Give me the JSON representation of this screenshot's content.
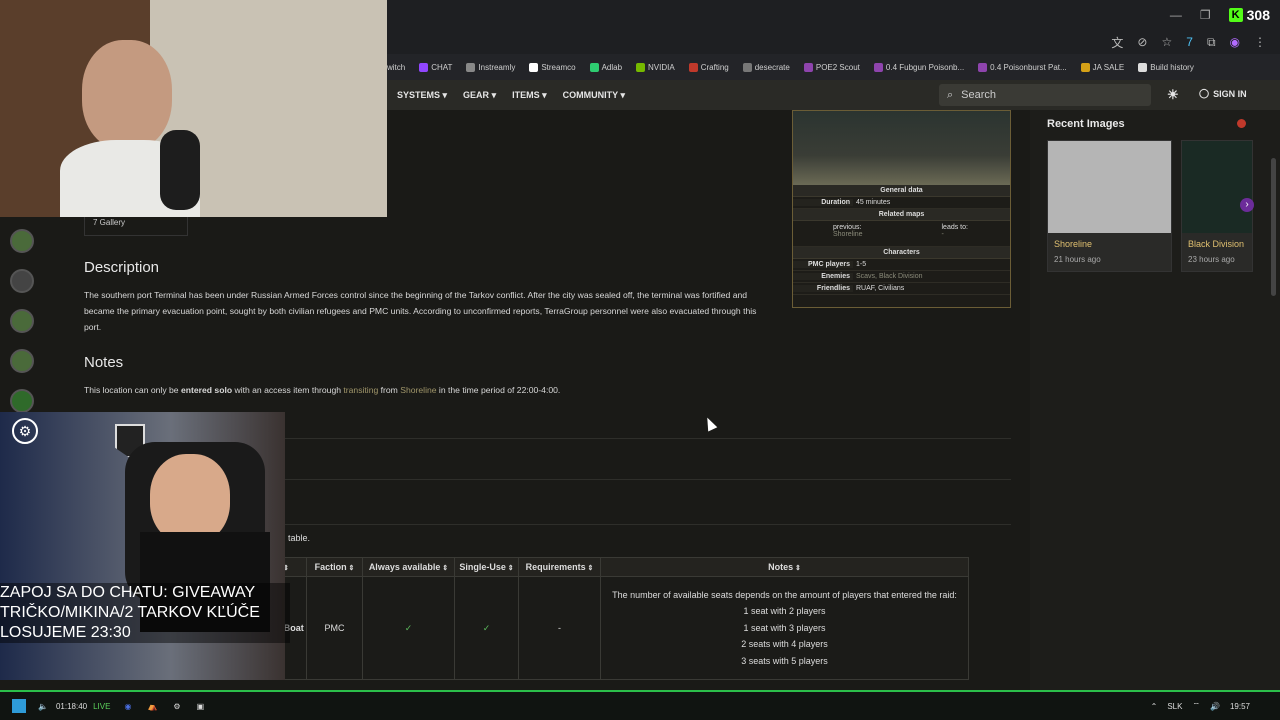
{
  "browser": {
    "score": "308",
    "bookmarks": [
      {
        "label": "witch",
        "color": "#9146ff"
      },
      {
        "label": "CHAT",
        "color": "#9146ff"
      },
      {
        "label": "Instreamly",
        "color": "#888888"
      },
      {
        "label": "Streamco",
        "color": "#ffffff"
      },
      {
        "label": "Adlab",
        "color": "#2ecc71"
      },
      {
        "label": "NVIDIA",
        "color": "#76b900"
      },
      {
        "label": "Crafting",
        "color": "#c0392b"
      },
      {
        "label": "desecrate",
        "color": "#777777"
      },
      {
        "label": "POE2 Scout",
        "color": "#8e44ad"
      },
      {
        "label": "0.4 Fubgun Poisonb...",
        "color": "#8e44ad"
      },
      {
        "label": "0.4 Poisonburst Pat...",
        "color": "#8e44ad"
      },
      {
        "label": "JA SALE",
        "color": "#d4a017"
      },
      {
        "label": "Build history",
        "color": "#dddddd"
      }
    ]
  },
  "nav": {
    "items": [
      "SYSTEMS",
      "GEAR",
      "ITEMS",
      "COMMUNITY"
    ],
    "search_placeholder": "Search",
    "signin": "SIGN IN"
  },
  "sidebar_toc": {
    "gallery": "7  Gallery"
  },
  "description": {
    "heading": "Description",
    "text": "The southern port Terminal has been under Russian Armed Forces control since the beginning of the Tarkov conflict. After the city was sealed off, the terminal was fortified and became the primary evacuation point, sought by both civilian refugees and PMC units. According to unconfirmed reports, TerraGroup personnel were also evacuated through this port."
  },
  "notes": {
    "heading": "Notes",
    "text_pre": "This location can only be ",
    "text_bold": "entered solo",
    "text_mid": " with an access item through ",
    "link1": "transiting",
    "text_mid2": " from ",
    "link2": "Shoreline",
    "text_post": " in the time period of 22:00-4:00."
  },
  "table_intro": "table.",
  "infobox": {
    "general_head": "General data",
    "duration_label": "Duration",
    "duration_value": "45 minutes",
    "related_head": "Related maps",
    "previous_label": "previous:",
    "previous_value": "Shoreline",
    "leads_label": "leads to:",
    "leads_value": "-",
    "characters_head": "Characters",
    "pmc_label": "PMC players",
    "pmc_value": "1-5",
    "enemies_label": "Enemies",
    "enemies_value": "Scavs, Black Division",
    "friendlies_label": "Friendlies",
    "friendlies_value": "RUAF, Civilians"
  },
  "recent": {
    "title": "Recent Images",
    "items": [
      {
        "name": "Shoreline",
        "time": "21 hours ago"
      },
      {
        "name": "Black Division",
        "time": "23 hours ago"
      }
    ]
  },
  "extract_table": {
    "headers": [
      "e",
      "Faction",
      "Always available",
      "Single-Use",
      "Requirements",
      "Notes"
    ],
    "row": {
      "name": "Zubr Boat",
      "faction": "PMC",
      "always": "✓",
      "single": "✓",
      "requirements": "-",
      "notes": [
        "The number of available seats depends on the amount of players that entered the raid:",
        "1 seat with 2 players",
        "1 seat with 3 players",
        "2 seats with 4 players",
        "3 seats with 5 players"
      ]
    }
  },
  "overlay": {
    "line1": "ZAPOJ SA DO CHATU: GIVEAWAY",
    "line2": "TRIČKO/MIKINA/2 TARKOV KĽÚČE",
    "line3": "LOSUJEME 23:30"
  },
  "taskbar": {
    "timer": "01:18:40",
    "live": "LIVE",
    "lang": "SLK",
    "clock": "19:57"
  }
}
